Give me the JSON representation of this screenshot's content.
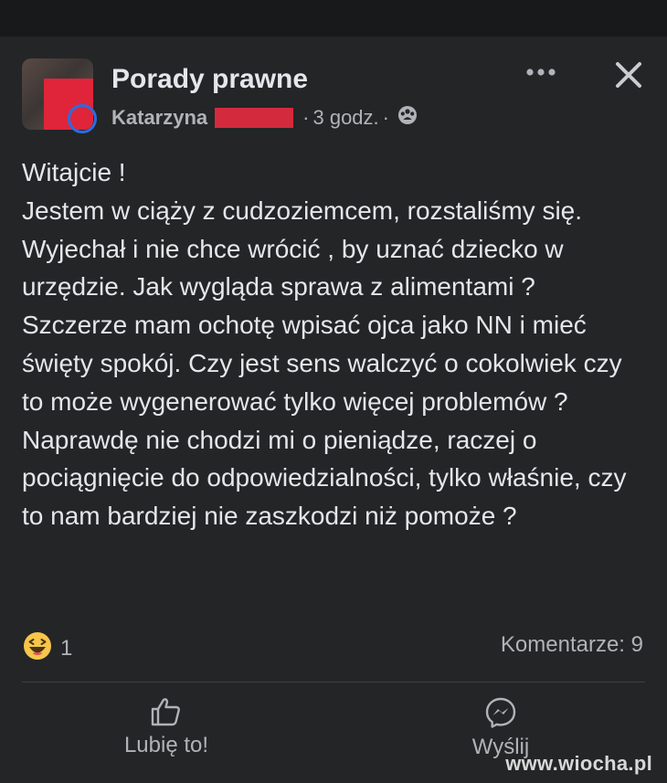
{
  "header": {
    "group_name": "Porady prawne",
    "author": "Katarzyna",
    "time": "3 godz.",
    "meta_sep": "·"
  },
  "post": {
    "text": "Witajcie !\nJestem w ciąży z cudzoziemcem, rozstaliśmy się. Wyjechał i nie chce wrócić , by uznać dziecko w urzędzie. Jak wygląda sprawa z alimentami ? Szczerze mam ochotę wpisać ojca jako NN i mieć święty spokój. Czy jest sens walczyć o cokolwiek czy to może wygenerować tylko więcej problemów ?\nNaprawdę nie chodzi mi o pieniądze, raczej o pociągnięcie do odpowiedzialności, tylko właśnie, czy to nam bardziej nie zaszkodzi niż pomoże ?"
  },
  "stats": {
    "reaction_count": "1",
    "comments": "Komentarze: 9"
  },
  "actions": {
    "like_label": "Lubię to!",
    "send_label": "Wyślij"
  },
  "watermark": "www.wiocha.pl",
  "icons": {
    "more": "more-icon",
    "close": "close-icon",
    "audience": "group-audience-icon",
    "reaction": "haha-reaction-icon",
    "like": "thumbs-up-icon",
    "messenger": "messenger-icon"
  },
  "colors": {
    "background": "#242526",
    "text": "#e4e6eb",
    "secondary": "#b0b3b8",
    "redaction": "#d42a3e"
  }
}
